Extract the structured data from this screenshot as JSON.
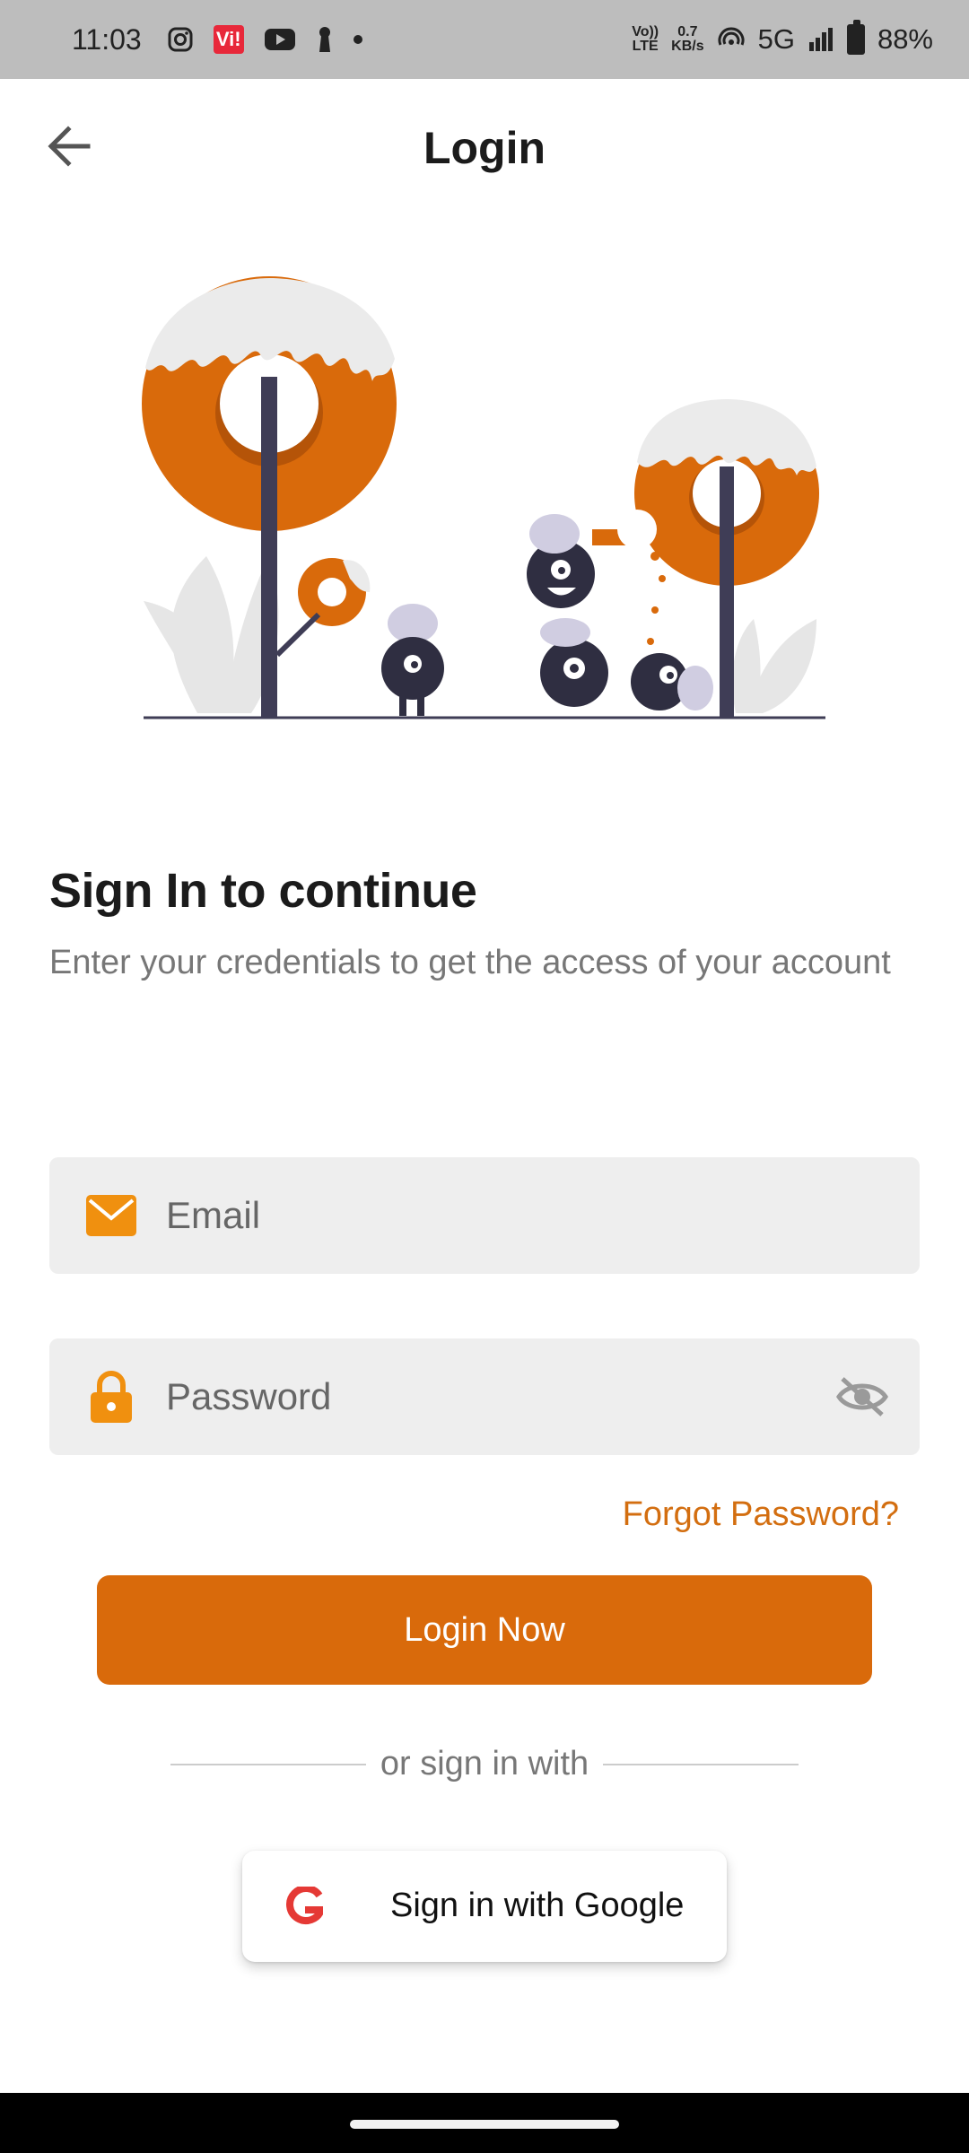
{
  "status_bar": {
    "time": "11:03",
    "vi_badge": "Vi!",
    "network_speed_value": "0.7",
    "network_speed_unit": "KB/s",
    "volte_top": "Vo))",
    "volte_bottom": "LTE",
    "network_type": "5G",
    "battery": "88%"
  },
  "app_bar": {
    "title": "Login",
    "back_icon": "arrow-left-icon"
  },
  "content": {
    "headline": "Sign In to continue",
    "subline": "Enter your credentials to get the access of your account"
  },
  "form": {
    "email_placeholder": "Email",
    "email_value": "",
    "password_placeholder": "Password",
    "password_value": "",
    "forgot_label": "Forgot Password?",
    "login_label": "Login Now",
    "divider_text": "or sign in with",
    "google_label": "Sign in with Google"
  },
  "colors": {
    "accent": "#d96a0b",
    "accent_text": "#d36e10",
    "field_bg": "#eeeeee",
    "icon_orange": "#f0900f"
  }
}
